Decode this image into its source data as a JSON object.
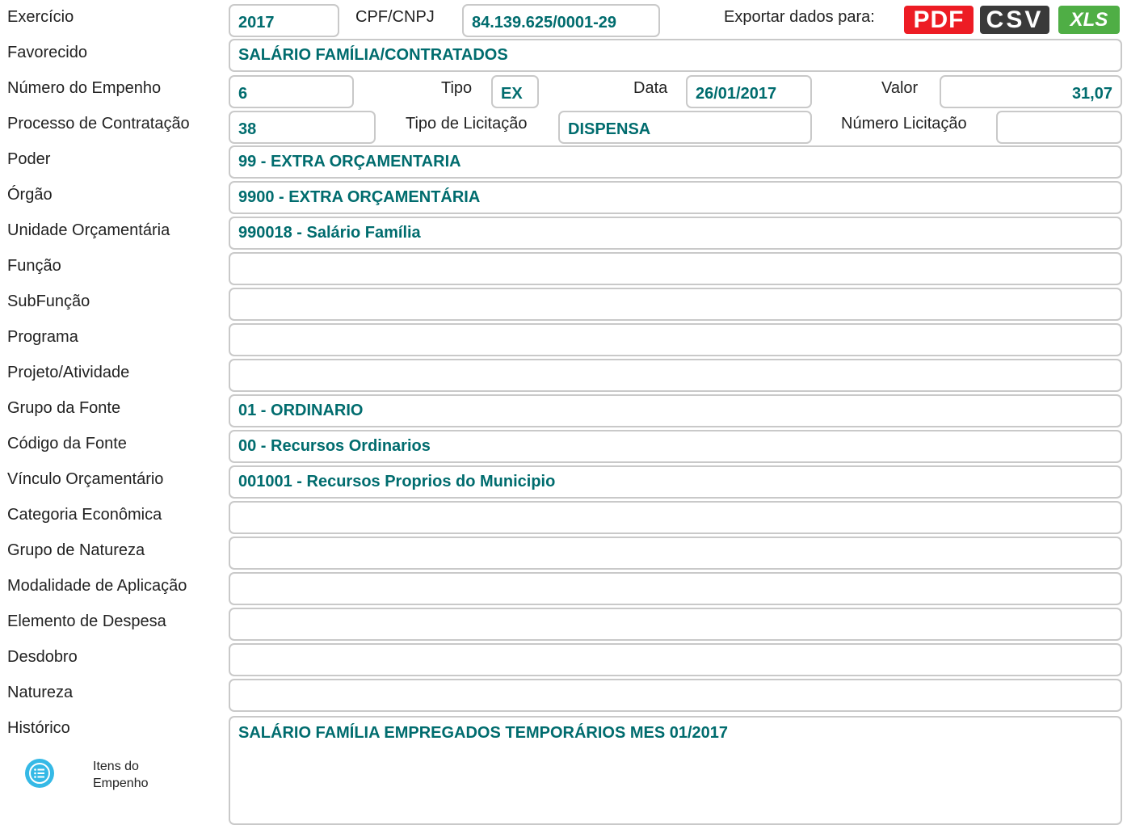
{
  "labels": {
    "exercicio": "Exercício",
    "cpf_cnpj": "CPF/CNPJ",
    "exportar": "Exportar dados para:",
    "favorecido": "Favorecido",
    "numero_empenho": "Número do Empenho",
    "tipo": "Tipo",
    "data": "Data",
    "valor": "Valor",
    "processo_contratacao": "Processo de Contratação",
    "tipo_licitacao": "Tipo de Licitação",
    "numero_licitacao": "Número Licitação",
    "poder": "Poder",
    "orgao": "Órgão",
    "unidade_orcamentaria": "Unidade Orçamentária",
    "funcao": "Função",
    "subfuncao": "SubFunção",
    "programa": "Programa",
    "projeto_atividade": "Projeto/Atividade",
    "grupo_fonte": "Grupo da Fonte",
    "codigo_fonte": "Código da Fonte",
    "vinculo_orcamentario": "Vínculo Orçamentário",
    "categoria_economica": "Categoria Econômica",
    "grupo_natureza": "Grupo de Natureza",
    "modalidade_aplicacao": "Modalidade de Aplicação",
    "elemento_despesa": "Elemento de Despesa",
    "desdobro": "Desdobro",
    "natureza": "Natureza",
    "historico": "Histórico"
  },
  "values": {
    "exercicio": "2017",
    "cpf_cnpj": "84.139.625/0001-29",
    "favorecido": "SALÁRIO FAMÍLIA/CONTRATADOS",
    "numero_empenho": "6",
    "tipo": "EX",
    "data": "26/01/2017",
    "valor": "31,07",
    "processo_contratacao": "38",
    "tipo_licitacao": "DISPENSA",
    "numero_licitacao": "",
    "poder": "99 - EXTRA ORÇAMENTARIA",
    "orgao": "9900 - EXTRA ORÇAMENTÁRIA",
    "unidade_orcamentaria": "990018 - Salário Família",
    "funcao": "",
    "subfuncao": "",
    "programa": "",
    "projeto_atividade": "",
    "grupo_fonte": "01 - ORDINARIO",
    "codigo_fonte": "00 - Recursos Ordinarios",
    "vinculo_orcamentario": "001001 - Recursos Proprios do Municipio",
    "categoria_economica": "",
    "grupo_natureza": "",
    "modalidade_aplicacao": "",
    "elemento_despesa": "",
    "desdobro": "",
    "natureza": "",
    "historico": "SALÁRIO FAMÍLIA EMPREGADOS TEMPORÁRIOS MES 01/2017"
  },
  "export": {
    "pdf": "PDF",
    "csv": "CSV",
    "xls": "XLS"
  },
  "items_link": {
    "line1": "Itens do",
    "line2": "Empenho",
    "icon": "list-icon"
  },
  "colors": {
    "value_text": "#006c6e",
    "pdf": "#ed1c24",
    "csv": "#3a3a3a",
    "xls": "#4fae45",
    "items_icon": "#35b9e6"
  }
}
